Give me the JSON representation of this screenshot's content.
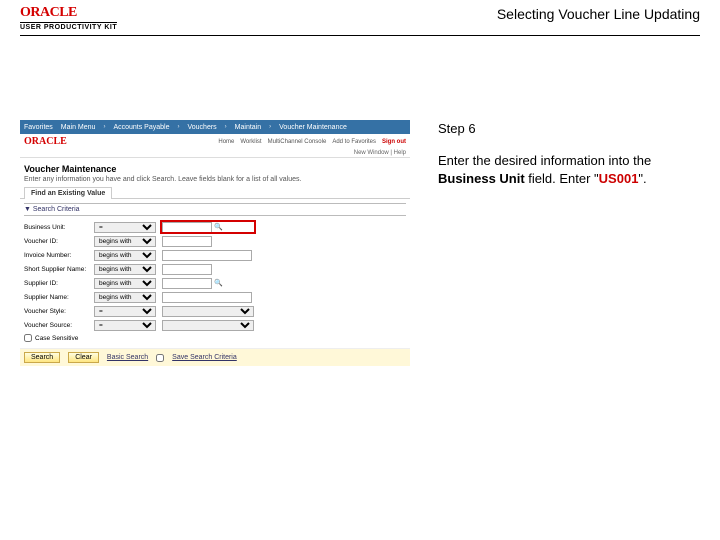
{
  "header": {
    "logo_main": "ORACLE",
    "logo_sub": "USER PRODUCTIVITY KIT",
    "doc_title": "Selecting Voucher Line Updating"
  },
  "side": {
    "step": "Step 6",
    "text1": "Enter the desired information into the ",
    "bold1": "Business Unit",
    "text2": " field. Enter \"",
    "red1": "US001",
    "text3": "\"."
  },
  "topbar": [
    "Favorites",
    "Main Menu",
    "Accounts Payable",
    "Vouchers",
    "Maintain",
    "Voucher Maintenance"
  ],
  "orabar_links": [
    "Home",
    "Worklist",
    "MultiChannel Console",
    "Add to Favorites",
    "Sign out"
  ],
  "subbar": "New Window | Help",
  "page_title": "Voucher Maintenance",
  "page_desc": "Enter any information you have and click Search. Leave fields blank for a list of all values.",
  "tab": "Find an Existing Value",
  "sect_hdr": "▼ Search Criteria",
  "form": [
    {
      "label": "Business Unit:",
      "op": "=",
      "value": "",
      "lookup": true,
      "highlight": true
    },
    {
      "label": "Voucher ID:",
      "op": "begins with",
      "value": "",
      "lookup": false
    },
    {
      "label": "Invoice Number:",
      "op": "begins with",
      "value": "",
      "lookup": false
    },
    {
      "label": "Short Supplier Name:",
      "op": "begins with",
      "value": "",
      "lookup": false
    },
    {
      "label": "Supplier ID:",
      "op": "begins with",
      "value": "",
      "lookup": true
    },
    {
      "label": "Supplier Name:",
      "op": "begins with",
      "value": "",
      "lookup": false
    },
    {
      "label": "Voucher Style:",
      "op": "=",
      "value": "",
      "lookup": false,
      "select": true
    },
    {
      "label": "Voucher Source:",
      "op": "=",
      "value": "",
      "lookup": false,
      "select": true
    }
  ],
  "case_sensitive": "Case Sensitive",
  "buttons": {
    "search": "Search",
    "clear": "Clear",
    "basic": "Basic Search",
    "save": "Save Search Criteria"
  }
}
